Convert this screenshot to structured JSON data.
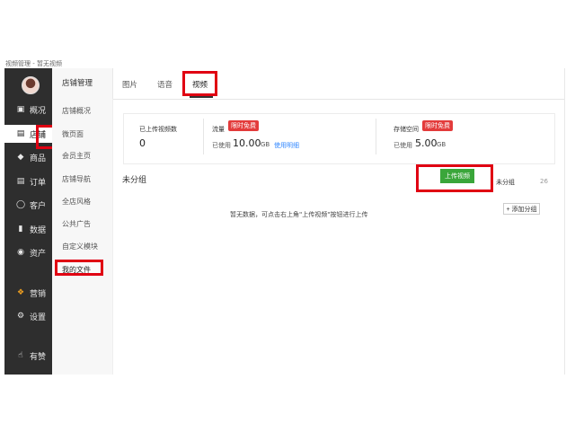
{
  "window": {
    "title": "视频管理 - 暂无视频"
  },
  "sidebar": {
    "items": [
      {
        "label": "概况",
        "icon": "monitor-icon",
        "active": false
      },
      {
        "label": "店铺",
        "icon": "store-icon",
        "active": true
      },
      {
        "label": "商品",
        "icon": "tag-icon",
        "active": false
      },
      {
        "label": "订单",
        "icon": "order-list-icon",
        "active": false
      },
      {
        "label": "客户",
        "icon": "user-icon",
        "active": false
      },
      {
        "label": "数据",
        "icon": "bar-chart-icon",
        "active": false
      },
      {
        "label": "资产",
        "icon": "wallet-icon",
        "active": false
      },
      {
        "label": "营销",
        "icon": "grid-icon",
        "active": false
      },
      {
        "label": "设置",
        "icon": "gear-icon",
        "active": false
      },
      {
        "label": "有赞",
        "icon": "thumbs-up-icon",
        "active": false
      }
    ]
  },
  "subnav": {
    "title": "店铺管理",
    "items": [
      "店铺概况",
      "微页面",
      "会员主页",
      "店铺导航",
      "全店风格",
      "公共广告",
      "自定义模块",
      "我的文件"
    ],
    "active": "我的文件"
  },
  "tabs": [
    {
      "label": "图片",
      "active": false
    },
    {
      "label": "语音",
      "active": false
    },
    {
      "label": "视频",
      "active": true
    }
  ],
  "stats": {
    "uploaded": {
      "label": "已上传视频数",
      "value": "0"
    },
    "traffic": {
      "label": "流量",
      "badge": "限时免费",
      "used_prefix": "已使用",
      "value": "10.00",
      "unit": "GB",
      "link": "使用明细"
    },
    "storage": {
      "label": "存储空间",
      "badge": "限时免费",
      "used_prefix": "已使用",
      "value": "5.00",
      "unit": "GB"
    }
  },
  "group": {
    "title": "未分组",
    "upload_button": "上传视频",
    "ungrouped_label": "未分组",
    "ungrouped_count": "26",
    "empty_message": "暂无数据，可点击右上角\"上传视频\"按钮进行上传",
    "add_group_button": "+ 添加分组"
  },
  "colors": {
    "highlight": "#e00012",
    "badge": "#e33b3b",
    "upload": "#3aa63a",
    "link": "#3388ff",
    "sidebar": "#2e2e2e"
  }
}
